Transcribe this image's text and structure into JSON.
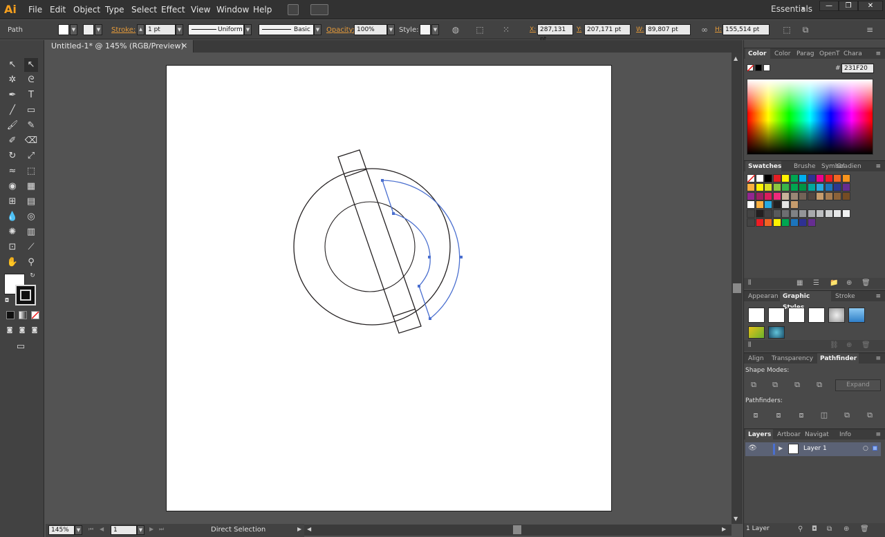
{
  "app": {
    "logo": "Ai",
    "menu": [
      "File",
      "Edit",
      "Object",
      "Type",
      "Select",
      "Effect",
      "View",
      "Window",
      "Help"
    ],
    "workspace": "Essentials",
    "workspace_arrow": "▼",
    "window_buttons": [
      "—",
      "❐",
      "✕"
    ]
  },
  "control_bar": {
    "selection_type": "Path",
    "stroke_label": "Stroke:",
    "stroke_value": "1 pt",
    "stroke_profile": "Uniform",
    "brush": "Basic",
    "opacity_label": "Opacity:",
    "opacity_value": "100%",
    "style_label": "Style:",
    "x_label": "X:",
    "x_value": "287,131 pt",
    "y_label": "Y:",
    "y_value": "207,171 pt",
    "w_label": "W:",
    "w_value": "89,807 pt",
    "h_label": "H:",
    "h_value": "155,514 pt"
  },
  "document": {
    "tab_title": "Untitled-1* @ 145% (RGB/Preview)",
    "close": "✕"
  },
  "status_bar": {
    "zoom": "145%",
    "artboard_number": "1",
    "tool_name": "Direct Selection"
  },
  "panels": {
    "color": {
      "tabs": [
        "Color",
        "Color",
        "Parag",
        "OpenT",
        "Chara"
      ],
      "hex_symbol": "#",
      "hex_value": "231F20"
    },
    "swatches": {
      "tabs": [
        "Swatches",
        "Brushe",
        "Symbol",
        "Gradien"
      ]
    },
    "graphic_styles": {
      "tabs": [
        "Appearan",
        "Graphic Styles",
        "Stroke"
      ]
    },
    "pathfinder": {
      "tabs": [
        "Align",
        "Transparency",
        "Pathfinder"
      ],
      "shape_modes_label": "Shape Modes:",
      "expand_label": "Expand",
      "pathfinders_label": "Pathfinders:"
    },
    "layers": {
      "tabs": [
        "Layers",
        "Artboar",
        "Navigat",
        "Info"
      ],
      "layer_name": "Layer 1",
      "footer_count": "1 Layer"
    }
  },
  "colors": {
    "accent_orange": "#e69b3a",
    "selection_blue": "#4a6fcf",
    "stroke_dark": "#231F20"
  }
}
